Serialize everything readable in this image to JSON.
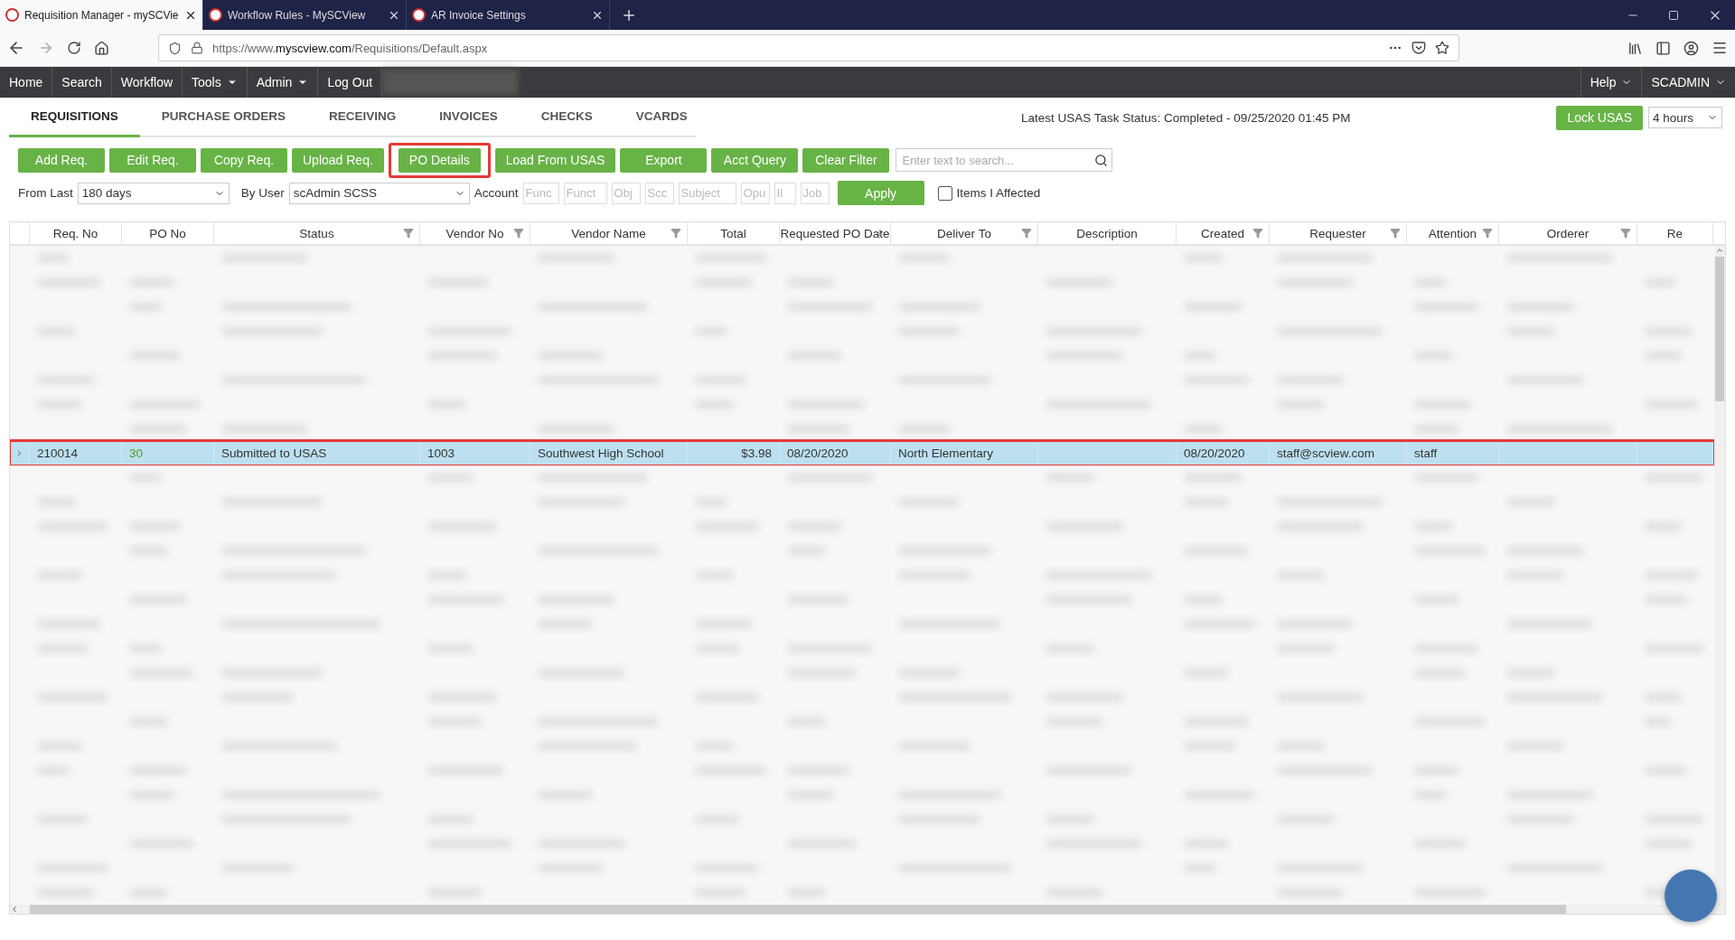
{
  "browser": {
    "tabs": [
      {
        "title": "Requisition Manager - mySCVie",
        "selected": true
      },
      {
        "title": "Workflow Rules - MySCView",
        "selected": false
      },
      {
        "title": "AR Invoice Settings",
        "selected": false
      }
    ],
    "url": {
      "prefix": "https://www.",
      "domain": "myscview.com",
      "path": "/Requisitions/Default.aspx"
    }
  },
  "nav": {
    "items": [
      {
        "label": "Home",
        "dropdown": false
      },
      {
        "label": "Search",
        "dropdown": false
      },
      {
        "label": "Workflow",
        "dropdown": false
      },
      {
        "label": "Tools",
        "dropdown": true
      },
      {
        "label": "Admin",
        "dropdown": true
      },
      {
        "label": "Log Out",
        "dropdown": false
      }
    ],
    "right": [
      {
        "label": "Help",
        "dropdown": true
      },
      {
        "label": "SCADMIN",
        "dropdown": true
      }
    ]
  },
  "modules": [
    {
      "label": "REQUISITIONS",
      "selected": true
    },
    {
      "label": "PURCHASE ORDERS",
      "selected": false
    },
    {
      "label": "RECEIVING",
      "selected": false
    },
    {
      "label": "INVOICES",
      "selected": false
    },
    {
      "label": "CHECKS",
      "selected": false
    },
    {
      "label": "VCARDS",
      "selected": false
    }
  ],
  "task_status": "Latest USAS Task Status: Completed - 09/25/2020 01:45 PM",
  "lock": {
    "button": "Lock USAS",
    "duration": "4 hours"
  },
  "toolbar": {
    "buttons": [
      {
        "label": "Add Req.",
        "highlighted": false
      },
      {
        "label": "Edit Req.",
        "highlighted": false
      },
      {
        "label": "Copy Req.",
        "highlighted": false
      },
      {
        "label": "Upload Req.",
        "highlighted": false
      },
      {
        "label": "PO Details",
        "highlighted": true
      },
      {
        "label": "Load From USAS",
        "highlighted": false
      },
      {
        "label": "Export",
        "highlighted": false
      },
      {
        "label": "Acct Query",
        "highlighted": false
      },
      {
        "label": "Clear Filter",
        "highlighted": false
      }
    ],
    "search": {
      "placeholder": "Enter text to search..."
    }
  },
  "filters": {
    "from_last_label": "From Last",
    "from_last": "180 days",
    "by_user_label": "By User",
    "by_user": "scAdmin SCSS",
    "account_label": "Account",
    "account_fields": [
      {
        "placeholder": "Func"
      },
      {
        "placeholder": "Funct"
      },
      {
        "placeholder": "Obj"
      },
      {
        "placeholder": "Scc"
      },
      {
        "placeholder": "Subject"
      },
      {
        "placeholder": "Opu"
      },
      {
        "placeholder": "Il"
      },
      {
        "placeholder": "Job"
      }
    ],
    "apply": "Apply",
    "items_affected": {
      "label": "Items I Affected",
      "checked": false
    }
  },
  "table": {
    "columns": [
      {
        "label": "Req. No",
        "kind": "none"
      },
      {
        "label": "PO No",
        "kind": "none"
      },
      {
        "label": "Status",
        "kind": "filter"
      },
      {
        "label": "Vendor No",
        "kind": "filter"
      },
      {
        "label": "Vendor Name",
        "kind": "filter"
      },
      {
        "label": "Total",
        "kind": "none"
      },
      {
        "label": "Requested PO Date",
        "kind": "sort"
      },
      {
        "label": "Deliver To",
        "kind": "filter"
      },
      {
        "label": "Description",
        "kind": "none"
      },
      {
        "label": "Created",
        "kind": "filter"
      },
      {
        "label": "Requester",
        "kind": "filter"
      },
      {
        "label": "Attention",
        "kind": "filter"
      },
      {
        "label": "Orderer",
        "kind": "filter"
      },
      {
        "label": "Re",
        "kind": "none"
      }
    ],
    "rows": [
      {
        "kind": "blurred"
      },
      {
        "kind": "blurred"
      },
      {
        "kind": "blurred"
      },
      {
        "kind": "blurred"
      },
      {
        "kind": "blurred"
      },
      {
        "kind": "blurred"
      },
      {
        "kind": "blurred"
      },
      {
        "kind": "blurred"
      },
      {
        "kind": "data",
        "selected": true,
        "highlighted": true,
        "cells": [
          "210014",
          "30",
          "Submitted to USAS",
          "1003",
          "Southwest High School",
          "$3.98",
          "08/20/2020",
          "North Elementary",
          "",
          "08/20/2020",
          "staff@scview.com",
          "staff",
          "",
          ""
        ]
      },
      {
        "kind": "blurred"
      },
      {
        "kind": "blurred"
      },
      {
        "kind": "blurred"
      },
      {
        "kind": "blurred"
      },
      {
        "kind": "blurred"
      },
      {
        "kind": "blurred"
      },
      {
        "kind": "blurred"
      },
      {
        "kind": "blurred"
      },
      {
        "kind": "blurred"
      },
      {
        "kind": "blurred"
      },
      {
        "kind": "blurred"
      },
      {
        "kind": "blurred"
      },
      {
        "kind": "blurred"
      },
      {
        "kind": "blurred"
      },
      {
        "kind": "blurred"
      },
      {
        "kind": "blurred"
      },
      {
        "kind": "blurred"
      },
      {
        "kind": "blurred"
      }
    ]
  }
}
